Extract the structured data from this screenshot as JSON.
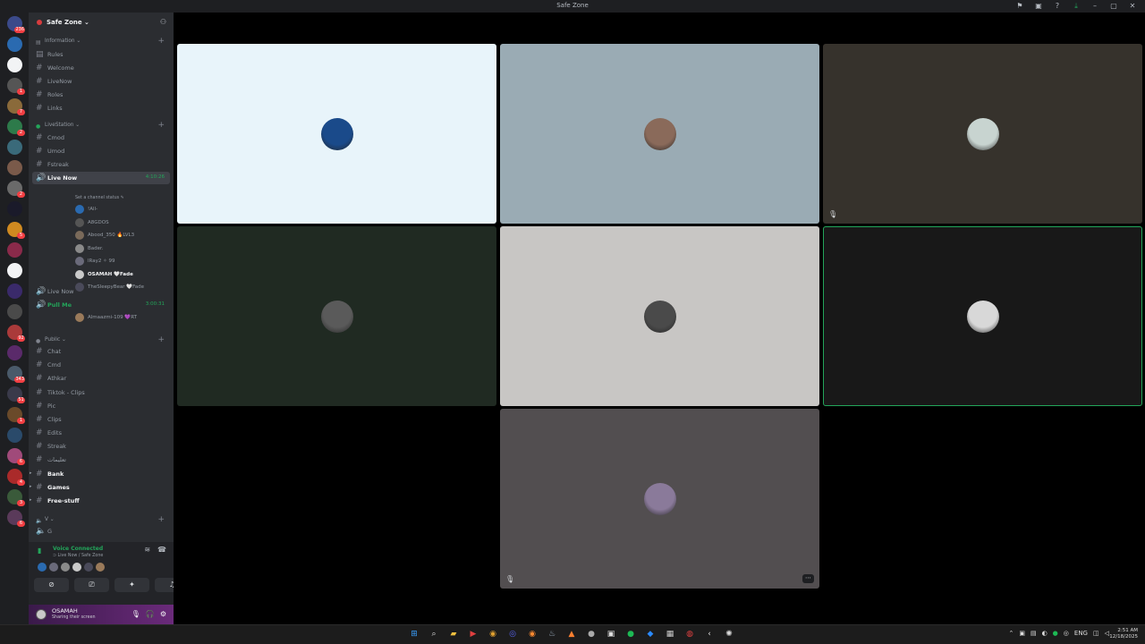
{
  "window": {
    "title": "Safe Zone",
    "tb_icons": [
      "inbox-icon",
      "pip-icon",
      "help-icon",
      "download-icon",
      "minimize-icon",
      "maximize-icon",
      "close-icon"
    ]
  },
  "rail": {
    "servers": [
      {
        "color": "#3b4a8a",
        "badge": "236"
      },
      {
        "color": "#2a6ab0",
        "badge": ""
      },
      {
        "color": "#f2f3f5",
        "badge": ""
      },
      {
        "color": "#555555",
        "badge": "1"
      },
      {
        "color": "#8a6a3a",
        "badge": "7"
      },
      {
        "color": "#2d7a4a",
        "badge": "2"
      },
      {
        "color": "#3a6a7a",
        "badge": ""
      },
      {
        "color": "#7a5a4a",
        "badge": ""
      },
      {
        "color": "#6a6a6a",
        "badge": "2"
      },
      {
        "color": "#1a1a2a",
        "badge": ""
      },
      {
        "color": "#d08a20",
        "badge": "5"
      },
      {
        "color": "#8a2a4a",
        "badge": ""
      },
      {
        "color": "#f2f3f5",
        "badge": ""
      },
      {
        "color": "#3a2a6a",
        "badge": ""
      },
      {
        "color": "#4a4a4a",
        "badge": ""
      },
      {
        "color": "#aa3a3a",
        "badge": "92"
      },
      {
        "color": "#5a2a6a",
        "badge": ""
      },
      {
        "color": "#4a5a6a",
        "badge": "343"
      },
      {
        "color": "#3a3a4a",
        "badge": "51"
      },
      {
        "color": "#6a4a2a",
        "badge": "1"
      },
      {
        "color": "#2a4a6a",
        "badge": ""
      },
      {
        "color": "#a04a7a",
        "badge": "6"
      },
      {
        "color": "#aa2a2a",
        "badge": "4"
      },
      {
        "color": "#3a5a3a",
        "badge": "3"
      },
      {
        "color": "#5a3a5a",
        "badge": "6"
      }
    ]
  },
  "guild": {
    "name": "Safe Zone ⌄"
  },
  "channels": {
    "cat_information": "Information ⌄",
    "rules": "Rules",
    "welcome": "Welcome",
    "livenow_text": "LiveNow",
    "roles": "Roles",
    "links": "Links",
    "cat_livestation": "LiveStation ⌄",
    "cmod": "Cmod",
    "umod": "Umod",
    "fstreak": "Fstreak",
    "live_now_active": "Live Now",
    "live_now_timer": "4:10:26",
    "channel_status": "Set a channel status ✎",
    "live_now_2": "Live Now",
    "pull_me": "Pull Me",
    "pull_me_timer": "3:00:31",
    "cat_public": "Public ⌄",
    "chat": "Chat",
    "cmd": "Cmd",
    "athkar": "Athkar",
    "tiktok_clips": "Tiktok - Clips",
    "pic": "Pic",
    "clips": "Clips",
    "edits": "Edits",
    "streak": "Streak",
    "arabic": "تعليمات",
    "bank": "Bank",
    "games": "Games",
    "free_stuff": "Free-stuff",
    "cat_v": "V ⌄",
    "g": "G"
  },
  "members": [
    {
      "name": "!All-",
      "color": "#2a6ab0",
      "live": false,
      "mic": ""
    },
    {
      "name": "A8GDOS",
      "color": "#555555",
      "live": false,
      "mic": ""
    },
    {
      "name": "Abood_350 🔥LVL3",
      "color": "#7a6a5a",
      "live": false,
      "mic": "🎙"
    },
    {
      "name": "Bader.",
      "color": "#8a8a8a",
      "live": false,
      "mic": ""
    },
    {
      "name": "lRay2 ✧ 99",
      "color": "#6a6a7a",
      "live": false,
      "mic": ""
    },
    {
      "name": "OSAMAH 🤍Fade",
      "color": "#c9c9c9",
      "live": true,
      "mic": ""
    },
    {
      "name": "TheSleepyBear 🤍Fade",
      "color": "#4a4a5a",
      "live": false,
      "mic": "🎙"
    }
  ],
  "pull_member": {
    "name": "Almaazmi-109 💜RT",
    "color": "#9a7a5a"
  },
  "voice": {
    "title": "Voice Connected",
    "subtitle": "⊃ Live Now / Safe Zone",
    "avatar_colors": [
      "#2a6ab0",
      "#6a6a7a",
      "#8a8a8a",
      "#c9c9c9",
      "#4a4a5a",
      "#9a7a5a"
    ]
  },
  "user": {
    "name": "OSAMAH",
    "status": "Sharing their screen"
  },
  "tiles": [
    {
      "bg": "#e8f4fa",
      "face": "#1a4a8a",
      "mic": "",
      "more": false,
      "speaking": false
    },
    {
      "bg": "#9aabb4",
      "face": "#8a6a5a",
      "mic": "",
      "more": false,
      "speaking": false
    },
    {
      "bg": "#36322c",
      "face": "#c8d4d0",
      "mic": "🎙",
      "more": false,
      "speaking": false
    },
    {
      "bg": "#202a22",
      "face": "#5a5a5a",
      "mic": "",
      "more": false,
      "speaking": false
    },
    {
      "bg": "#c8c6c4",
      "face": "#4a4a4a",
      "mic": "",
      "more": false,
      "speaking": false
    },
    {
      "bg": "#181818",
      "face": "#d8d8d8",
      "mic": "",
      "more": false,
      "speaking": true
    },
    {
      "bg": "#524e50",
      "face": "#8a7a9a",
      "mic": "🎙",
      "more": true,
      "speaking": false
    }
  ],
  "taskbar": {
    "apps": [
      {
        "icon": "windows-start-icon",
        "glyph": "⊞",
        "color": "#3aa0ff"
      },
      {
        "icon": "search-icon",
        "glyph": "⌕",
        "color": "#ddd"
      },
      {
        "icon": "file-explorer-icon",
        "glyph": "▰",
        "color": "#f0c040"
      },
      {
        "icon": "video-app-icon",
        "glyph": "▶",
        "color": "#e04040"
      },
      {
        "icon": "chrome-icon",
        "glyph": "◉",
        "color": "#e0a030"
      },
      {
        "icon": "discord-icon",
        "glyph": "◎",
        "color": "#5865f2"
      },
      {
        "icon": "firefox-icon",
        "glyph": "◉",
        "color": "#ff8a30"
      },
      {
        "icon": "steam-icon",
        "glyph": "♨",
        "color": "#9ab"
      },
      {
        "icon": "app-icon",
        "glyph": "▲",
        "color": "#ff8030"
      },
      {
        "icon": "obs-icon",
        "glyph": "●",
        "color": "#aaa"
      },
      {
        "icon": "terminal-icon",
        "glyph": "▣",
        "color": "#ddd"
      },
      {
        "icon": "spotify-icon",
        "glyph": "●",
        "color": "#1db954"
      },
      {
        "icon": "edge-icon",
        "glyph": "◆",
        "color": "#2a8aff"
      },
      {
        "icon": "terminal-2-icon",
        "glyph": "▦",
        "color": "#ccc"
      },
      {
        "icon": "record-icon",
        "glyph": "◍",
        "color": "#e04040"
      },
      {
        "icon": "back-icon",
        "glyph": "‹",
        "color": "#ddd"
      },
      {
        "icon": "chatgpt-icon",
        "glyph": "✺",
        "color": "#ddd"
      }
    ],
    "tray": {
      "language": "ENG"
    },
    "clock": {
      "time": "2:51 AM",
      "date": "12/18/2025"
    }
  }
}
